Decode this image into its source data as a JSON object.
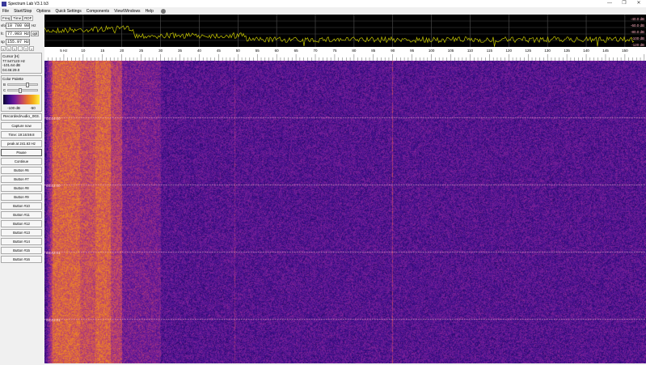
{
  "window": {
    "title": "Spectrum Lab V3.1 b3",
    "controls": [
      "—",
      "❐",
      "✕"
    ]
  },
  "menu": [
    "File",
    "Start/Stop",
    "Options",
    "Quick Settings",
    "Components",
    "View/Windows",
    "Help"
  ],
  "left": {
    "tabs": [
      "Freq",
      "Time",
      "RDF"
    ],
    "vfo": {
      "label": "vfo",
      "value": "10 700 000",
      "unit": "Hz"
    },
    "fc": {
      "label": "fc",
      "value": "77.983 Hz",
      "button": "opt"
    },
    "sp": {
      "label": "sp",
      "value": "155.97 Hz"
    },
    "arrows": [
      "<",
      "<",
      "<",
      "-",
      "+",
      ">"
    ],
    "cursor": {
      "title": "Cursor [H]",
      "freq": "77.547123 Hz",
      "level": "-101.64 dB",
      "time": "04:46:29.0"
    },
    "palette": {
      "title": "Color Palette",
      "b": "B",
      "c": "C",
      "min": "-100 dB",
      "max": "-50"
    },
    "file": "RecordedAudio_003.",
    "capture": "Capture now",
    "time": "Time:  19:16:59.8",
    "peak": "peak at 241.63 Hz",
    "buttons": [
      "Pause",
      "Continue",
      "Button #6",
      "Button #7",
      "Button #8",
      "Button #9",
      "Button #10",
      "Button #11",
      "Button #12",
      "Button #13",
      "Button #14",
      "Button #15",
      "Button #16"
    ]
  },
  "spectrum": {
    "db_labels": [
      "-40.0 dB",
      "-60.0 dB",
      "-80.0 dB",
      "-100 dB",
      "-120 dB"
    ],
    "trace_color": "#c8c800"
  },
  "axis": {
    "unit": "Hz",
    "ticks": [
      5,
      10,
      15,
      20,
      25,
      30,
      35,
      40,
      45,
      50,
      55,
      60,
      65,
      70,
      75,
      80,
      85,
      90,
      95,
      100,
      105,
      110,
      115,
      120,
      125,
      130,
      135,
      140,
      145,
      150
    ]
  },
  "waterfall": {
    "time_labels": [
      "04:44:00",
      "04:43:00",
      "04:42:01",
      "04:41:01"
    ]
  }
}
